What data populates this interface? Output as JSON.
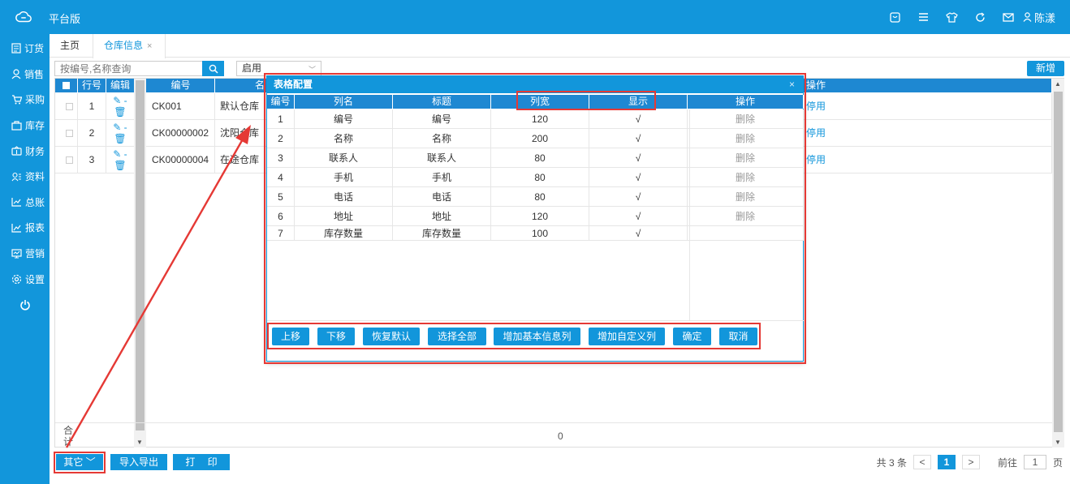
{
  "app": {
    "title": "平台版",
    "user": "陈漾",
    "colors": {
      "primary": "#1296db",
      "annotation": "#e53935"
    }
  },
  "sidebar": {
    "items": [
      {
        "icon": "order-icon",
        "label": "订货"
      },
      {
        "icon": "sales-icon",
        "label": "销售"
      },
      {
        "icon": "purchase-icon",
        "label": "采购"
      },
      {
        "icon": "stock-icon",
        "label": "库存"
      },
      {
        "icon": "finance-icon",
        "label": "财务"
      },
      {
        "icon": "data-icon",
        "label": "资料"
      },
      {
        "icon": "ledger-icon",
        "label": "总账"
      },
      {
        "icon": "report-icon",
        "label": "报表"
      },
      {
        "icon": "marketing-icon",
        "label": "营销"
      },
      {
        "icon": "settings-icon",
        "label": "设置"
      }
    ]
  },
  "tabs": {
    "home": "主页",
    "active": "仓库信息",
    "close": "×"
  },
  "toolbar": {
    "search_placeholder": "按编号,名称查询",
    "status": "启用",
    "new_label": "新增"
  },
  "grid": {
    "headers": {
      "row_no": "行号",
      "edit": "编辑",
      "code": "编号",
      "name": "名",
      "operation": "操作"
    },
    "rows": [
      {
        "no": "1",
        "code": "CK001",
        "name": "默认仓库",
        "op": "停用"
      },
      {
        "no": "2",
        "code": "CK00000002",
        "name": "沈阳仓库",
        "op": "停用"
      },
      {
        "no": "3",
        "code": "CK00000004",
        "name": "在途仓库",
        "op": "停用"
      }
    ],
    "sum_label": "合计",
    "sum_value": "0"
  },
  "dialog": {
    "title": "表格配置",
    "close": "×",
    "headers": {
      "no": "编号",
      "column": "列名",
      "caption": "标题",
      "width": "列宽",
      "show": "显示",
      "op": "操作"
    },
    "rows": [
      {
        "no": "1",
        "column": "编号",
        "caption": "编号",
        "width": "120",
        "show": "√",
        "op": "删除"
      },
      {
        "no": "2",
        "column": "名称",
        "caption": "名称",
        "width": "200",
        "show": "√",
        "op": "删除"
      },
      {
        "no": "3",
        "column": "联系人",
        "caption": "联系人",
        "width": "80",
        "show": "√",
        "op": "删除"
      },
      {
        "no": "4",
        "column": "手机",
        "caption": "手机",
        "width": "80",
        "show": "√",
        "op": "删除"
      },
      {
        "no": "5",
        "column": "电话",
        "caption": "电话",
        "width": "80",
        "show": "√",
        "op": "删除"
      },
      {
        "no": "6",
        "column": "地址",
        "caption": "地址",
        "width": "120",
        "show": "√",
        "op": "删除"
      },
      {
        "no": "7",
        "column": "库存数量",
        "caption": "库存数量",
        "width": "100",
        "show": "√",
        "op": ""
      }
    ],
    "buttons": {
      "up": "上移",
      "down": "下移",
      "reset": "恢复默认",
      "select_all": "选择全部",
      "add_basic": "增加基本信息列",
      "add_custom": "增加自定义列",
      "ok": "确定",
      "cancel": "取消"
    }
  },
  "bottom": {
    "other": "其它",
    "import_export": "导入导出",
    "print": "打　 印",
    "total": "共 3 条",
    "prev": "<",
    "current_page": "1",
    "next": ">",
    "goto": "前往",
    "goto_value": "1",
    "page_unit": "页"
  }
}
